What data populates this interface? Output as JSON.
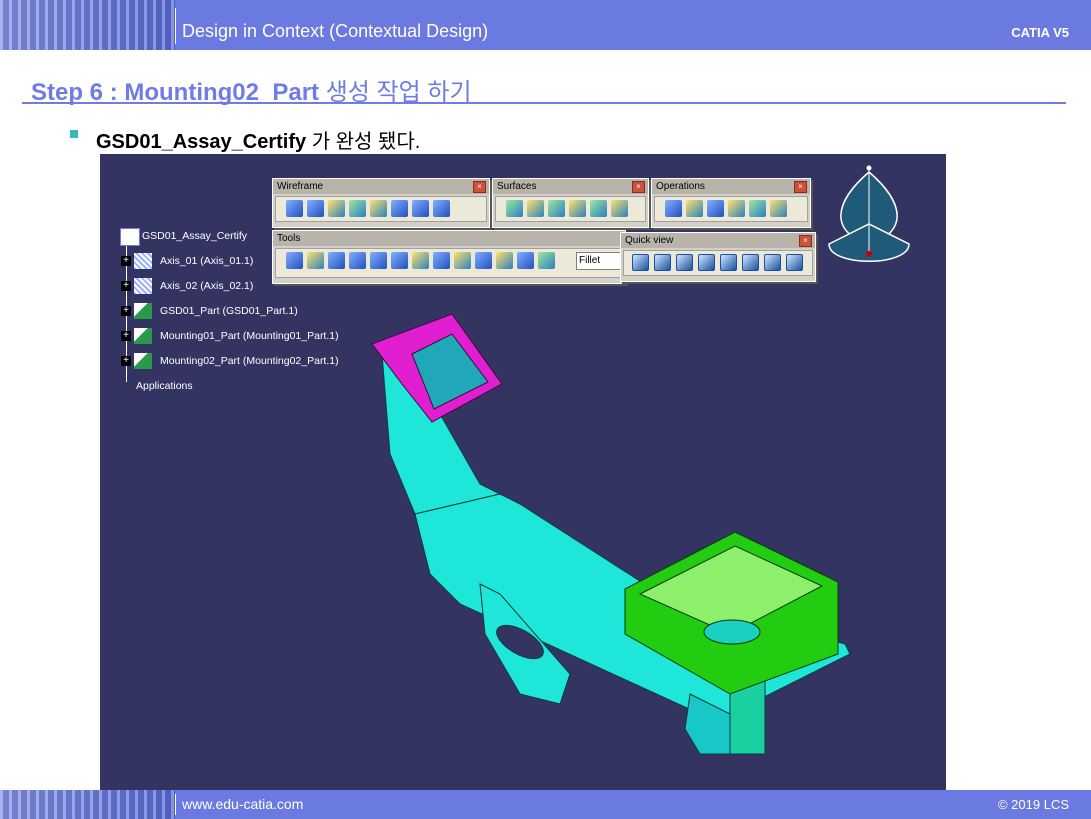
{
  "header": {
    "title": "Design in Context (Contextual Design)",
    "brand": "CATIA V5"
  },
  "step": {
    "title_en": "Step 6 : Mounting02_Part",
    "title_kr": "생성 작업 하기"
  },
  "bullet": {
    "bold": "GSD01_Assay_Certify",
    "rest": "가 완성 됐다."
  },
  "tree": {
    "root": "GSD01_Assay_Certify",
    "items": [
      {
        "label": "Axis_01 (Axis_01.1)",
        "icon": "axis-icon"
      },
      {
        "label": "Axis_02 (Axis_02.1)",
        "icon": "axis-icon"
      },
      {
        "label": "GSD01_Part (GSD01_Part.1)",
        "icon": "part-icon"
      },
      {
        "label": "Mounting01_Part (Mounting01_Part.1)",
        "icon": "part-icon"
      },
      {
        "label": "Mounting02_Part (Mounting02_Part.1)",
        "icon": "part-icon"
      }
    ],
    "applications": "Applications"
  },
  "toolbars": {
    "wireframe": "Wireframe",
    "surfaces": "Surfaces",
    "operations": "Operations",
    "tools": "Tools",
    "quick_view": "Quick view",
    "fillet_box": "Fillet Body"
  },
  "footer": {
    "url": "www.edu-catia.com",
    "copyright": "© 2019 LCS"
  },
  "colors": {
    "accent": "#6f7be6",
    "viewport_bg": "#343463",
    "part_cyan": "#1ee6d8",
    "part_green": "#22cc10",
    "part_magenta": "#e020d0"
  }
}
